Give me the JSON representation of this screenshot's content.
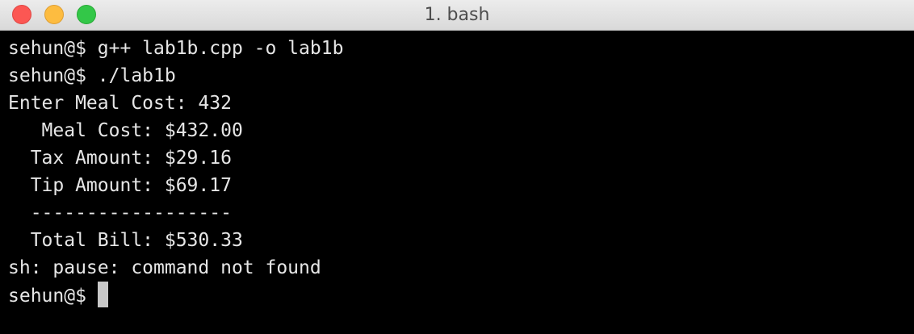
{
  "window": {
    "title": "1. bash"
  },
  "terminal": {
    "lines": [
      "sehun@$ g++ lab1b.cpp -o lab1b",
      "sehun@$ ./lab1b",
      "Enter Meal Cost: 432",
      "   Meal Cost: $432.00",
      "  Tax Amount: $29.16",
      "  Tip Amount: $69.17",
      "  ------------------",
      "  Total Bill: $530.33",
      "sh: pause: command not found"
    ],
    "prompt": "sehun@$ "
  }
}
